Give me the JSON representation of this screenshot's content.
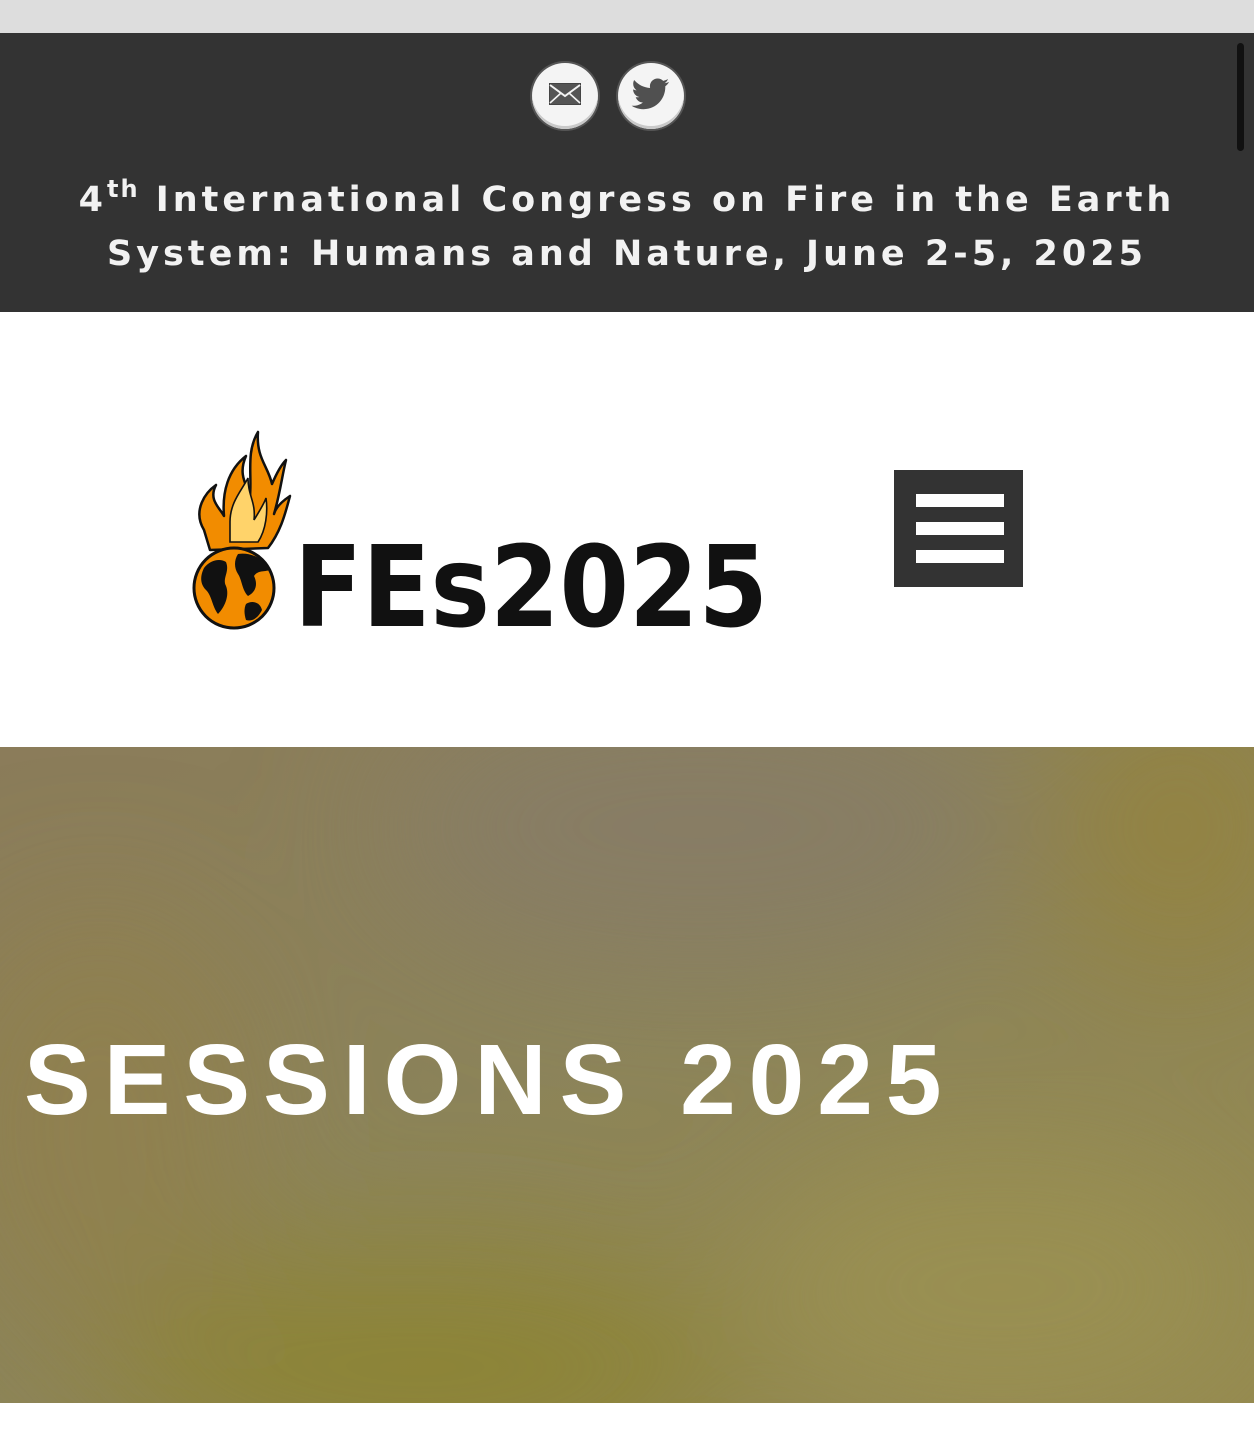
{
  "topbar": {
    "social": [
      {
        "name": "email",
        "icon": "email-icon"
      },
      {
        "name": "twitter",
        "icon": "twitter-icon"
      }
    ],
    "tagline": {
      "ordinal_number": "4",
      "ordinal_suffix": "th",
      "text": " International Congress on Fire in the Earth System: Humans and Nature, June 2-5, 2025"
    }
  },
  "header": {
    "logo_text": "FEs2025",
    "menu_icon": "hamburger-menu-icon"
  },
  "hero": {
    "title": "SESSIONS 2025"
  },
  "colors": {
    "topbar_bg": "#333333",
    "menu_button_bg": "#333333",
    "flame_orange": "#f28c00",
    "hero_tint": "#8e8652"
  }
}
